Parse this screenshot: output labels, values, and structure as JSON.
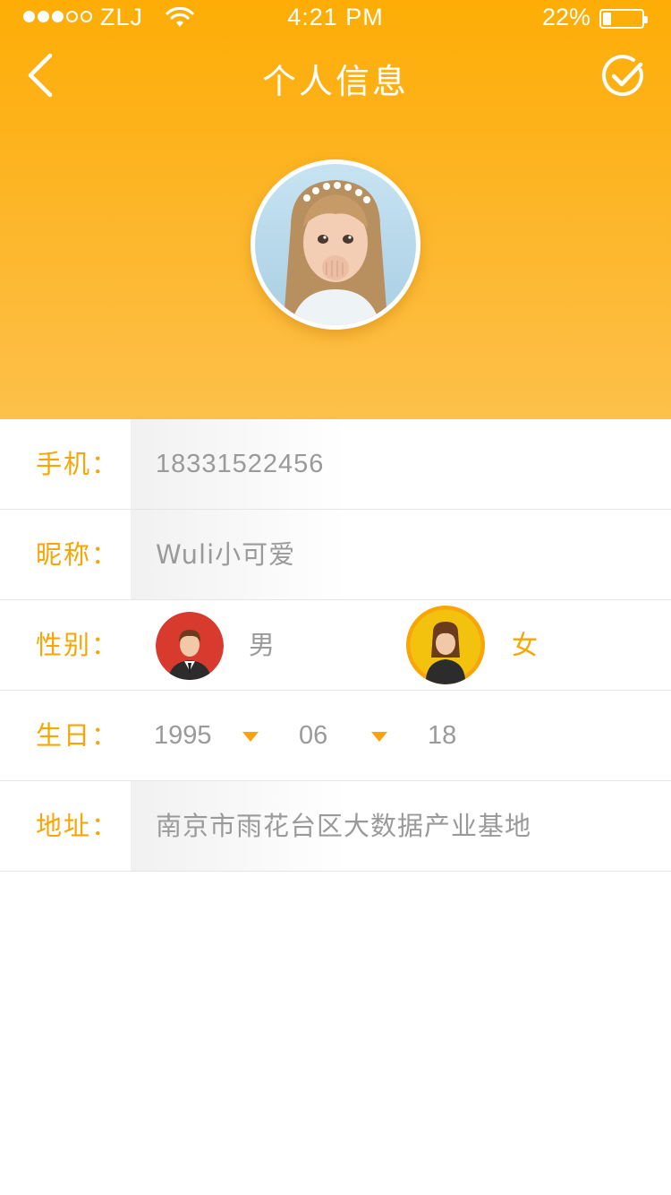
{
  "status_bar": {
    "carrier": "ZLJ",
    "time": "4:21 PM",
    "battery_percent": "22%",
    "battery_level": 0.22
  },
  "nav": {
    "title": "个人信息",
    "back_icon": "chevron-left-icon",
    "confirm_icon": "check-circle-icon"
  },
  "profile": {
    "avatar": "girl-portrait-avatar"
  },
  "form": {
    "phone": {
      "label": "手机：",
      "value": "18331522456"
    },
    "nickname": {
      "label": "昵称：",
      "value": "Wuli小可爱"
    },
    "gender": {
      "label": "性别：",
      "male_label": "男",
      "female_label": "女",
      "selected": "女"
    },
    "birthday": {
      "label": "生日：",
      "year": "1995",
      "month": "06",
      "day": "18"
    },
    "address": {
      "label": "地址：",
      "value": "南京市雨花台区大数据产业基地"
    }
  },
  "colors": {
    "accent": "#f8a505",
    "header_top": "#fdad05",
    "header_bottom": "#fdc04a",
    "male_icon_bg": "#d83a2e",
    "female_icon_bg": "#f2c20f",
    "value_text": "#9a9a9a"
  }
}
